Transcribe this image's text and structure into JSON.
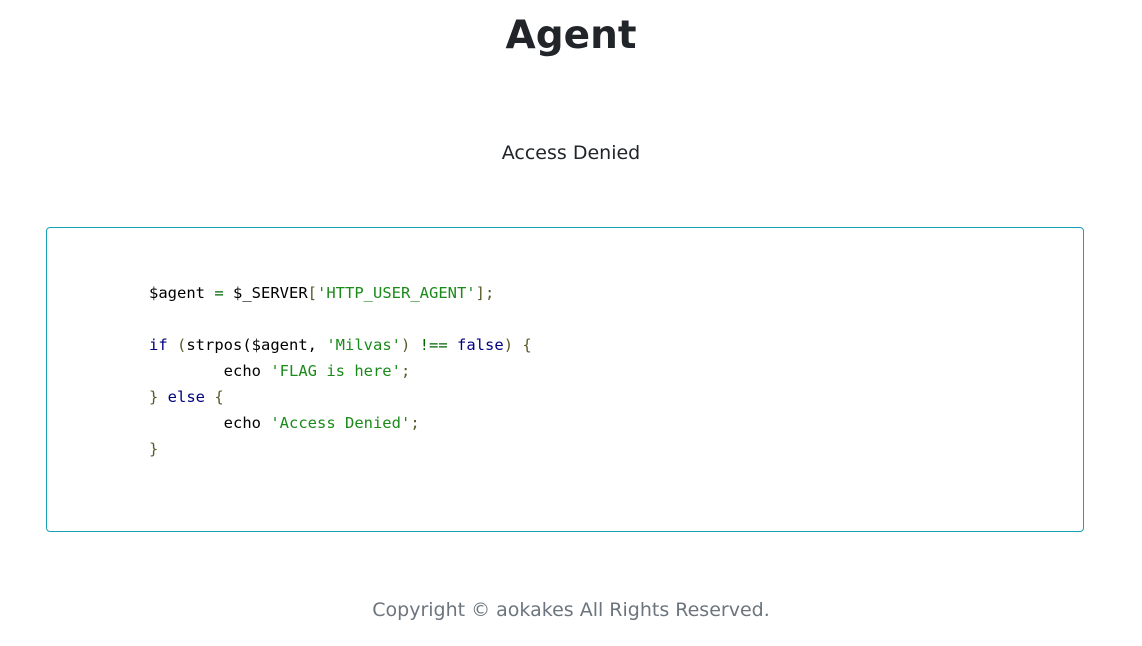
{
  "header": {
    "title": "Agent"
  },
  "main": {
    "status": "Access Denied",
    "code": {
      "line1": {
        "a": "$agent",
        "b": " = ",
        "c": "$_SERVER",
        "d": "[",
        "e": "'HTTP_USER_AGENT'",
        "f": "];"
      },
      "line3": {
        "a": "if",
        "b": " (",
        "c": "strpos(",
        "d": "$agent",
        "e": ", ",
        "f": "'Milvas'",
        "g": ") ",
        "h": "!==",
        "i": " ",
        "j": "false",
        "k": ") {"
      },
      "line4": {
        "a": "        echo ",
        "b": "'FLAG is here'",
        "c": ";"
      },
      "line5": {
        "a": "} ",
        "b": "else",
        "c": " {"
      },
      "line6": {
        "a": "        echo ",
        "b": "'Access Denied'",
        "c": ";"
      },
      "line7": {
        "a": "}"
      }
    }
  },
  "footer": {
    "copyright": "Copyright © aokakes All Rights Reserved."
  },
  "colors": {
    "border": "#17a2b8",
    "string": "#1a8a1a",
    "keyword": "#000080",
    "footer_text": "#6c757d"
  }
}
